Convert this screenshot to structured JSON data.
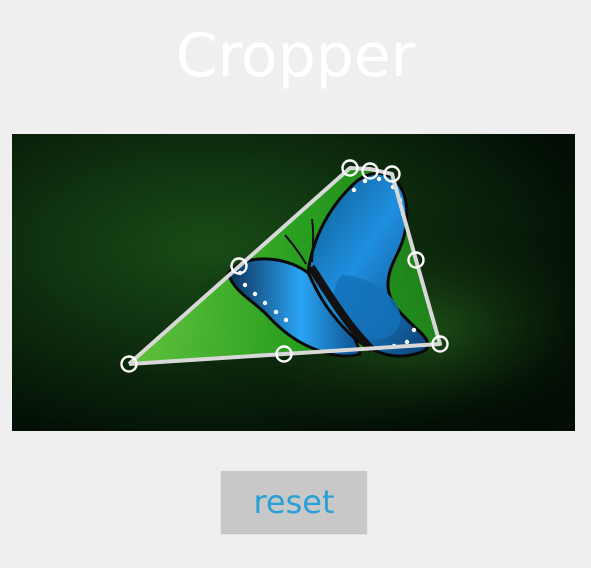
{
  "app": {
    "title": "Cropper",
    "reset_label": "reset"
  },
  "colors": {
    "background": "#efefef",
    "title_text": "#ffffff",
    "button_bg": "#c8c8c8",
    "button_text": "#2aa0d8",
    "crop_outline": "#d8d8d8",
    "handle": "#ffffff"
  },
  "icons": {
    "crop_handle": "crop-handle-icon"
  }
}
